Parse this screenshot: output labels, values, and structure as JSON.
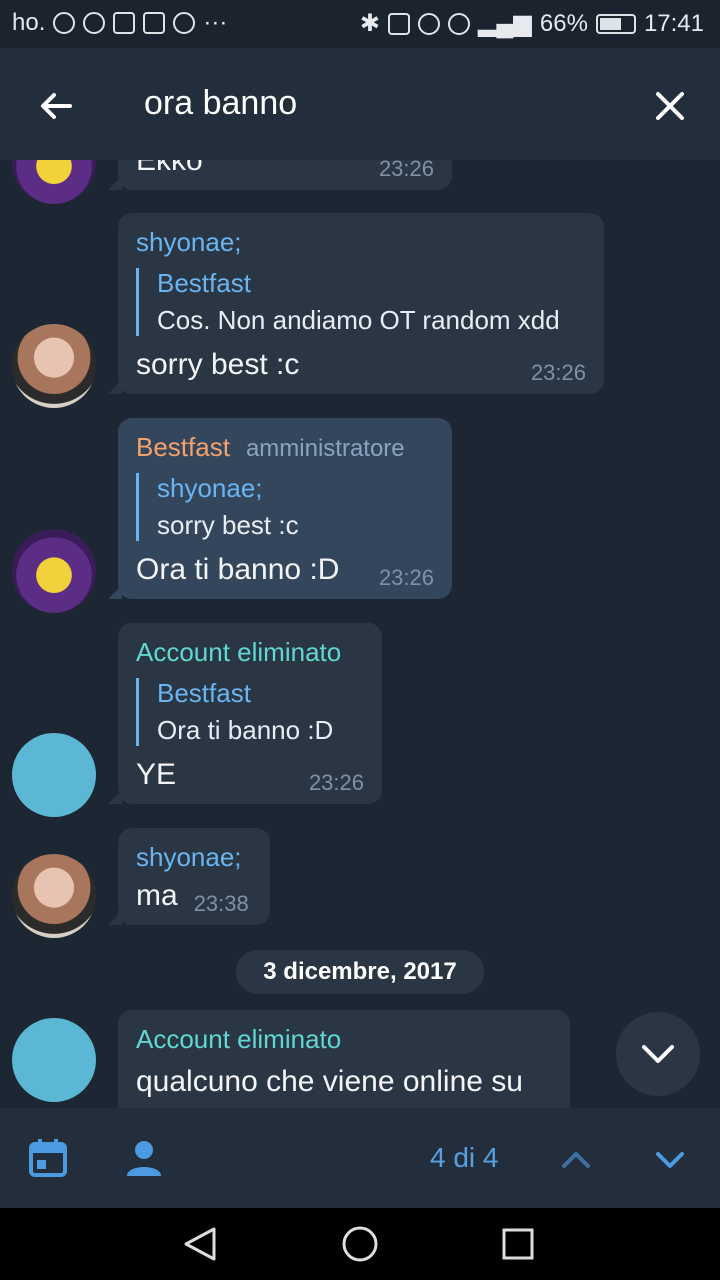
{
  "status_bar": {
    "carrier": "ho.",
    "battery": "66%",
    "battery_level": 0.66,
    "time": "17:41"
  },
  "header": {
    "search_query": "ora banno",
    "back_icon": "arrow-left-icon",
    "close_icon": "close-icon"
  },
  "messages": [
    {
      "text": "Ekko",
      "time": "23:26"
    },
    {
      "sender": "shyonae;",
      "reply_name": "Bestfast",
      "reply_text": "Cos. Non andiamo OT random xdd",
      "text": "sorry best :c",
      "time": "23:26"
    },
    {
      "sender": "Bestfast",
      "role": "amministratore",
      "reply_name": "shyonae;",
      "reply_text": "sorry best :c",
      "text": "Ora ti banno :D",
      "time": "23:26"
    },
    {
      "sender": "Account eliminato",
      "reply_name": "Bestfast",
      "reply_text": "Ora ti banno :D",
      "text": "YE",
      "time": "23:26"
    },
    {
      "sender": "shyonae;",
      "text": "ma",
      "time": "23:38"
    },
    {
      "sender": "Account eliminato",
      "text": "qualcuno che viene online su"
    }
  ],
  "date_separator": "3 dicembre, 2017",
  "bottom_bar": {
    "result_counter": "4 di 4"
  },
  "colors": {
    "background": "#1d2733",
    "bubble": "#2b3645",
    "bubble_highlight": "#34465c",
    "accent_blue": "#6ab4f0",
    "admin_orange": "#f3a26b",
    "deleted_teal": "#5fd8d2"
  }
}
